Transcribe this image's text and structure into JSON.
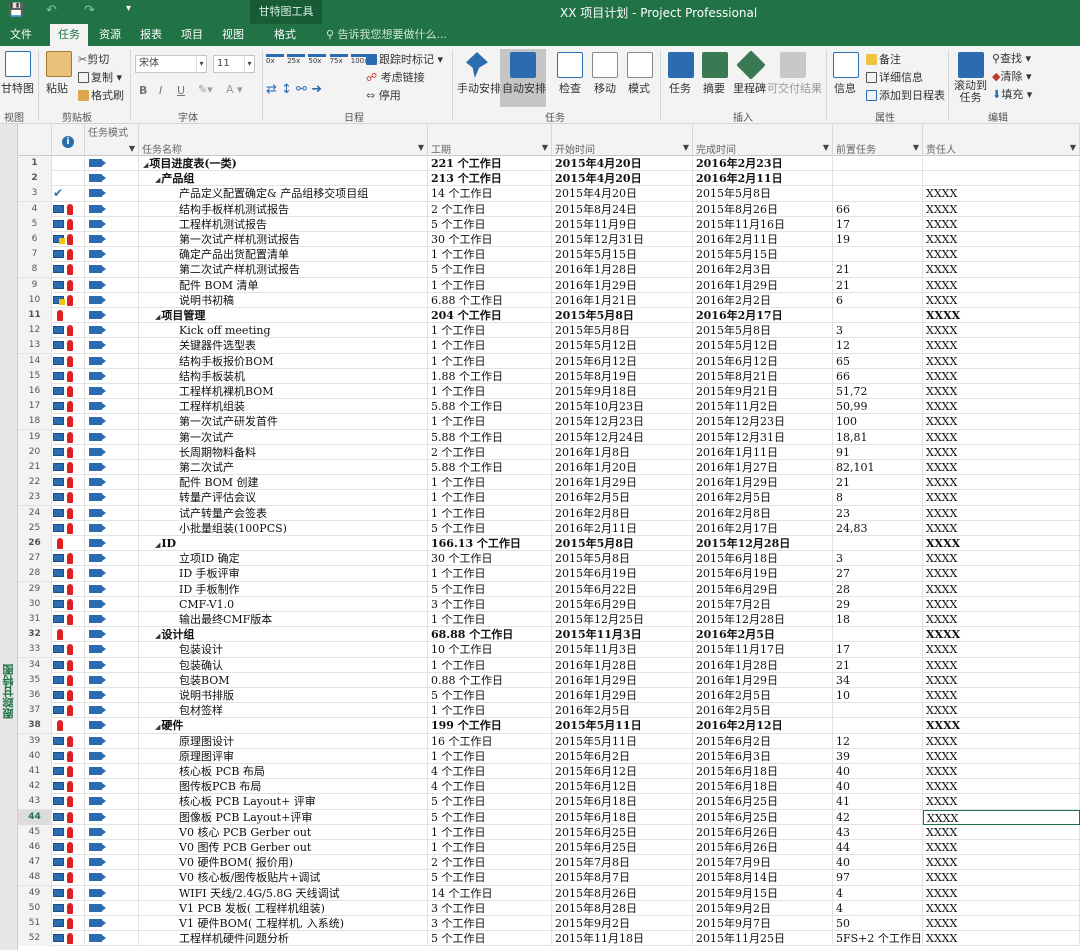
{
  "window": {
    "title": "XX 项目计划 - Project Professional",
    "context_tab": "甘特图工具"
  },
  "tabs": [
    "文件",
    "任务",
    "资源",
    "报表",
    "项目",
    "视图",
    "格式"
  ],
  "active_tab": "任务",
  "tell_me": "告诉我您想要做什么...",
  "ribbon": {
    "view": {
      "btn": "甘特图",
      "group": "视图"
    },
    "clipboard": {
      "paste": "粘贴",
      "cut": "剪切",
      "copy": "复制",
      "format_painter": "格式刷",
      "group": "剪贴板"
    },
    "font": {
      "name": "宋体",
      "size": "11",
      "bold": "B",
      "italic": "I",
      "underline": "U",
      "color_a": "A",
      "group": "字体"
    },
    "schedule": {
      "pct": [
        "0x",
        "25x",
        "50x",
        "75x",
        "100x"
      ],
      "track": "跟踪时标记",
      "respect": "考虑链接",
      "inactivate": "停用",
      "group": "日程"
    },
    "tasks": {
      "manual": "手动安排",
      "auto": "自动安排",
      "inspect": "检查",
      "move": "移动",
      "mode": "模式",
      "group": "任务"
    },
    "insert": {
      "task": "任务",
      "summary": "摘要",
      "milestone": "里程碑",
      "deliverable": "可交付结果",
      "group": "插入"
    },
    "properties": {
      "info": "信息",
      "notes": "备注",
      "details": "详细信息",
      "add_timeline": "添加到日程表",
      "group": "属性"
    },
    "editing": {
      "scroll": "滚动到",
      "scroll2": "任务",
      "find": "查找",
      "clear": "清除",
      "fill": "填充",
      "group": "编辑"
    }
  },
  "side_label": "跟踪甘特图",
  "columns": {
    "mode": "任务模式",
    "name": "任务名称",
    "duration": "工期",
    "start": "开始时间",
    "finish": "完成时间",
    "pred": "前置任务",
    "res": "责任人"
  },
  "rows": [
    {
      "id": "1",
      "lvl": 0,
      "sum": true,
      "ind": "",
      "name": "项目进度表(一类)",
      "dur": "221 个工作日",
      "start": "2015年4月20日",
      "fin": "2016年2月23日",
      "pred": "",
      "res": ""
    },
    {
      "id": "2",
      "lvl": 1,
      "sum": true,
      "ind": "",
      "name": "产品组",
      "dur": "213 个工作日",
      "start": "2015年4月20日",
      "fin": "2016年2月11日",
      "pred": "",
      "res": ""
    },
    {
      "id": "3",
      "lvl": 2,
      "sum": false,
      "ind": "check",
      "name": "产品定义配置确定& 产品组移交项目组",
      "dur": "14 个工作日",
      "start": "2015年4月20日",
      "fin": "2015年5月8日",
      "pred": "",
      "res": "XXXX"
    },
    {
      "id": "4",
      "lvl": 2,
      "sum": false,
      "ind": "cal",
      "name": "结构手板样机测试报告",
      "dur": "2 个工作日",
      "start": "2015年8月24日",
      "fin": "2015年8月26日",
      "pred": "66",
      "res": "XXXX"
    },
    {
      "id": "5",
      "lvl": 2,
      "sum": false,
      "ind": "cal",
      "name": "工程样机测试报告",
      "dur": "5 个工作日",
      "start": "2015年11月9日",
      "fin": "2015年11月16日",
      "pred": "17",
      "res": "XXXX"
    },
    {
      "id": "6",
      "lvl": 2,
      "sum": false,
      "ind": "warn",
      "name": "第一次试产样机测试报告",
      "dur": "30 个工作日",
      "start": "2015年12月31日",
      "fin": "2016年2月11日",
      "pred": "19",
      "res": "XXXX"
    },
    {
      "id": "7",
      "lvl": 2,
      "sum": false,
      "ind": "cal",
      "name": "确定产品出货配置清单",
      "dur": "1 个工作日",
      "start": "2015年5月15日",
      "fin": "2015年5月15日",
      "pred": "",
      "res": "XXXX"
    },
    {
      "id": "8",
      "lvl": 2,
      "sum": false,
      "ind": "cal",
      "name": "第二次试产样机测试报告",
      "dur": "5 个工作日",
      "start": "2016年1月28日",
      "fin": "2016年2月3日",
      "pred": "21",
      "res": "XXXX"
    },
    {
      "id": "9",
      "lvl": 2,
      "sum": false,
      "ind": "cal",
      "name": "配件 BOM 清单",
      "dur": "1 个工作日",
      "start": "2016年1月29日",
      "fin": "2016年1月29日",
      "pred": "21",
      "res": "XXXX"
    },
    {
      "id": "10",
      "lvl": 2,
      "sum": false,
      "ind": "warn",
      "name": "说明书初稿",
      "dur": "6.88 个工作日",
      "start": "2016年1月21日",
      "fin": "2016年2月2日",
      "pred": "6",
      "res": "XXXX"
    },
    {
      "id": "11",
      "lvl": 1,
      "sum": true,
      "ind": "person",
      "name": "项目管理",
      "dur": "204 个工作日",
      "start": "2015年5月8日",
      "fin": "2016年2月17日",
      "pred": "",
      "res": "XXXX"
    },
    {
      "id": "12",
      "lvl": 2,
      "sum": false,
      "ind": "cal",
      "name": "Kick off meeting",
      "dur": "1 个工作日",
      "start": "2015年5月8日",
      "fin": "2015年5月8日",
      "pred": "3",
      "res": "XXXX"
    },
    {
      "id": "13",
      "lvl": 2,
      "sum": false,
      "ind": "cal",
      "name": "关键器件选型表",
      "dur": "1 个工作日",
      "start": "2015年5月12日",
      "fin": "2015年5月12日",
      "pred": "12",
      "res": "XXXX"
    },
    {
      "id": "14",
      "lvl": 2,
      "sum": false,
      "ind": "cal",
      "name": "结构手板报价BOM",
      "dur": "1 个工作日",
      "start": "2015年6月12日",
      "fin": "2015年6月12日",
      "pred": "65",
      "res": "XXXX"
    },
    {
      "id": "15",
      "lvl": 2,
      "sum": false,
      "ind": "cal",
      "name": "结构手板装机",
      "dur": "1.88 个工作日",
      "start": "2015年8月19日",
      "fin": "2015年8月21日",
      "pred": "66",
      "res": "XXXX"
    },
    {
      "id": "16",
      "lvl": 2,
      "sum": false,
      "ind": "cal",
      "name": "工程样机裸机BOM",
      "dur": "1 个工作日",
      "start": "2015年9月18日",
      "fin": "2015年9月21日",
      "pred": "51,72",
      "res": "XXXX"
    },
    {
      "id": "17",
      "lvl": 2,
      "sum": false,
      "ind": "cal",
      "name": "工程样机组装",
      "dur": "5.88 个工作日",
      "start": "2015年10月23日",
      "fin": "2015年11月2日",
      "pred": "50,99",
      "res": "XXXX"
    },
    {
      "id": "18",
      "lvl": 2,
      "sum": false,
      "ind": "cal",
      "name": "第一次试产研发首件",
      "dur": "1 个工作日",
      "start": "2015年12月23日",
      "fin": "2015年12月23日",
      "pred": "100",
      "res": "XXXX"
    },
    {
      "id": "19",
      "lvl": 2,
      "sum": false,
      "ind": "cal",
      "name": "第一次试产",
      "dur": "5.88 个工作日",
      "start": "2015年12月24日",
      "fin": "2015年12月31日",
      "pred": "18,81",
      "res": "XXXX"
    },
    {
      "id": "20",
      "lvl": 2,
      "sum": false,
      "ind": "cal",
      "name": "长周期物料备料",
      "dur": "2 个工作日",
      "start": "2016年1月8日",
      "fin": "2016年1月11日",
      "pred": "91",
      "res": "XXXX"
    },
    {
      "id": "21",
      "lvl": 2,
      "sum": false,
      "ind": "cal",
      "name": "第二次试产",
      "dur": "5.88 个工作日",
      "start": "2016年1月20日",
      "fin": "2016年1月27日",
      "pred": "82,101",
      "res": "XXXX"
    },
    {
      "id": "22",
      "lvl": 2,
      "sum": false,
      "ind": "cal",
      "name": "配件 BOM 创建",
      "dur": "1 个工作日",
      "start": "2016年1月29日",
      "fin": "2016年1月29日",
      "pred": "21",
      "res": "XXXX"
    },
    {
      "id": "23",
      "lvl": 2,
      "sum": false,
      "ind": "cal",
      "name": "转量产评估会议",
      "dur": "1 个工作日",
      "start": "2016年2月5日",
      "fin": "2016年2月5日",
      "pred": "8",
      "res": "XXXX"
    },
    {
      "id": "24",
      "lvl": 2,
      "sum": false,
      "ind": "cal",
      "name": "试产转量产会签表",
      "dur": "1 个工作日",
      "start": "2016年2月8日",
      "fin": "2016年2月8日",
      "pred": "23",
      "res": "XXXX"
    },
    {
      "id": "25",
      "lvl": 2,
      "sum": false,
      "ind": "cal",
      "name": "小批量组装(100PCS)",
      "dur": "5 个工作日",
      "start": "2016年2月11日",
      "fin": "2016年2月17日",
      "pred": "24,83",
      "res": "XXXX"
    },
    {
      "id": "26",
      "lvl": 1,
      "sum": true,
      "ind": "person",
      "name": "ID",
      "dur": "166.13 个工作日",
      "start": "2015年5月8日",
      "fin": "2015年12月28日",
      "pred": "",
      "res": "XXXX"
    },
    {
      "id": "27",
      "lvl": 2,
      "sum": false,
      "ind": "cal",
      "name": "立项ID 确定",
      "dur": "30 个工作日",
      "start": "2015年5月8日",
      "fin": "2015年6月18日",
      "pred": "3",
      "res": "XXXX"
    },
    {
      "id": "28",
      "lvl": 2,
      "sum": false,
      "ind": "cal",
      "name": "ID 手板评审",
      "dur": "1 个工作日",
      "start": "2015年6月19日",
      "fin": "2015年6月19日",
      "pred": "27",
      "res": "XXXX"
    },
    {
      "id": "29",
      "lvl": 2,
      "sum": false,
      "ind": "cal",
      "name": "ID 手板制作",
      "dur": "5 个工作日",
      "start": "2015年6月22日",
      "fin": "2015年6月29日",
      "pred": "28",
      "res": "XXXX"
    },
    {
      "id": "30",
      "lvl": 2,
      "sum": false,
      "ind": "cal",
      "name": "CMF-V1.0",
      "dur": "3 个工作日",
      "start": "2015年6月29日",
      "fin": "2015年7月2日",
      "pred": "29",
      "res": "XXXX"
    },
    {
      "id": "31",
      "lvl": 2,
      "sum": false,
      "ind": "cal",
      "name": "输出最终CMF版本",
      "dur": "1 个工作日",
      "start": "2015年12月25日",
      "fin": "2015年12月28日",
      "pred": "18",
      "res": "XXXX"
    },
    {
      "id": "32",
      "lvl": 1,
      "sum": true,
      "ind": "person",
      "name": "设计组",
      "dur": "68.88 个工作日",
      "start": "2015年11月3日",
      "fin": "2016年2月5日",
      "pred": "",
      "res": "XXXX"
    },
    {
      "id": "33",
      "lvl": 2,
      "sum": false,
      "ind": "cal",
      "name": "包装设计",
      "dur": "10 个工作日",
      "start": "2015年11月3日",
      "fin": "2015年11月17日",
      "pred": "17",
      "res": "XXXX"
    },
    {
      "id": "34",
      "lvl": 2,
      "sum": false,
      "ind": "cal",
      "name": "包装确认",
      "dur": "1 个工作日",
      "start": "2016年1月28日",
      "fin": "2016年1月28日",
      "pred": "21",
      "res": "XXXX"
    },
    {
      "id": "35",
      "lvl": 2,
      "sum": false,
      "ind": "cal",
      "name": "包装BOM",
      "dur": "0.88 个工作日",
      "start": "2016年1月29日",
      "fin": "2016年1月29日",
      "pred": "34",
      "res": "XXXX"
    },
    {
      "id": "36",
      "lvl": 2,
      "sum": false,
      "ind": "cal",
      "name": "说明书排版",
      "dur": "5 个工作日",
      "start": "2016年1月29日",
      "fin": "2016年2月5日",
      "pred": "10",
      "res": "XXXX"
    },
    {
      "id": "37",
      "lvl": 2,
      "sum": false,
      "ind": "cal",
      "name": "包材签样",
      "dur": "1 个工作日",
      "start": "2016年2月5日",
      "fin": "2016年2月5日",
      "pred": "",
      "res": "XXXX"
    },
    {
      "id": "38",
      "lvl": 1,
      "sum": true,
      "ind": "person",
      "name": "硬件",
      "dur": "199 个工作日",
      "start": "2015年5月11日",
      "fin": "2016年2月12日",
      "pred": "",
      "res": "XXXX"
    },
    {
      "id": "39",
      "lvl": 2,
      "sum": false,
      "ind": "cal",
      "name": "原理图设计",
      "dur": "16 个工作日",
      "start": "2015年5月11日",
      "fin": "2015年6月2日",
      "pred": "12",
      "res": "XXXX"
    },
    {
      "id": "40",
      "lvl": 2,
      "sum": false,
      "ind": "cal",
      "name": "原理图评审",
      "dur": "1 个工作日",
      "start": "2015年6月2日",
      "fin": "2015年6月3日",
      "pred": "39",
      "res": "XXXX"
    },
    {
      "id": "41",
      "lvl": 2,
      "sum": false,
      "ind": "cal",
      "name": "核心板 PCB 布局",
      "dur": "4 个工作日",
      "start": "2015年6月12日",
      "fin": "2015年6月18日",
      "pred": "40",
      "res": "XXXX"
    },
    {
      "id": "42",
      "lvl": 2,
      "sum": false,
      "ind": "cal",
      "name": "图传板PCB 布局",
      "dur": "4 个工作日",
      "start": "2015年6月12日",
      "fin": "2015年6月18日",
      "pred": "40",
      "res": "XXXX"
    },
    {
      "id": "43",
      "lvl": 2,
      "sum": false,
      "ind": "cal",
      "name": "核心板 PCB Layout+ 评审",
      "dur": "5 个工作日",
      "start": "2015年6月18日",
      "fin": "2015年6月25日",
      "pred": "41",
      "res": "XXXX"
    },
    {
      "id": "44",
      "lvl": 2,
      "sum": false,
      "ind": "cal",
      "name": "图像板 PCB Layout+评审",
      "dur": "5 个工作日",
      "start": "2015年6月18日",
      "fin": "2015年6月25日",
      "pred": "42",
      "res": "XXXX"
    },
    {
      "id": "45",
      "lvl": 2,
      "sum": false,
      "ind": "cal",
      "name": "V0 核心 PCB Gerber out",
      "dur": "1 个工作日",
      "start": "2015年6月25日",
      "fin": "2015年6月26日",
      "pred": "43",
      "res": "XXXX"
    },
    {
      "id": "46",
      "lvl": 2,
      "sum": false,
      "ind": "cal",
      "name": "V0 图传 PCB Gerber out",
      "dur": "1 个工作日",
      "start": "2015年6月25日",
      "fin": "2015年6月26日",
      "pred": "44",
      "res": "XXXX"
    },
    {
      "id": "47",
      "lvl": 2,
      "sum": false,
      "ind": "cal",
      "name": "V0 硬件BOM( 报价用)",
      "dur": "2 个工作日",
      "start": "2015年7月8日",
      "fin": "2015年7月9日",
      "pred": "40",
      "res": "XXXX"
    },
    {
      "id": "48",
      "lvl": 2,
      "sum": false,
      "ind": "cal",
      "name": "V0 核心板/图传板贴片+调试",
      "dur": "5 个工作日",
      "start": "2015年8月7日",
      "fin": "2015年8月14日",
      "pred": "97",
      "res": "XXXX"
    },
    {
      "id": "49",
      "lvl": 2,
      "sum": false,
      "ind": "cal",
      "name": "WIFI 天线/2.4G/5.8G 天线调试",
      "dur": "14 个工作日",
      "start": "2015年8月26日",
      "fin": "2015年9月15日",
      "pred": "4",
      "res": "XXXX"
    },
    {
      "id": "50",
      "lvl": 2,
      "sum": false,
      "ind": "cal",
      "name": "V1 PCB 发板( 工程样机组装)",
      "dur": "3 个工作日",
      "start": "2015年8月28日",
      "fin": "2015年9月2日",
      "pred": "4",
      "res": "XXXX"
    },
    {
      "id": "51",
      "lvl": 2,
      "sum": false,
      "ind": "cal",
      "name": "V1 硬件BOM( 工程样机, 入系统)",
      "dur": "3 个工作日",
      "start": "2015年9月2日",
      "fin": "2015年9月7日",
      "pred": "50",
      "res": "XXXX"
    },
    {
      "id": "52",
      "lvl": 2,
      "sum": false,
      "ind": "cal",
      "name": "工程样机硬件问题分析",
      "dur": "5 个工作日",
      "start": "2015年11月18日",
      "fin": "2015年11月25日",
      "pred": "5FS+2 个工作日",
      "res": "XXXX"
    }
  ],
  "selected_row": "44"
}
